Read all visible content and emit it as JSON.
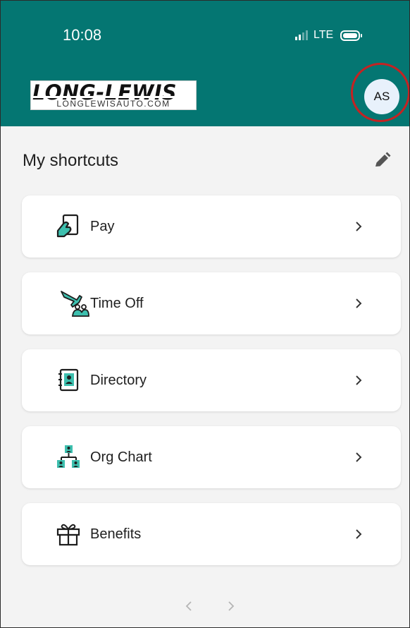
{
  "status_bar": {
    "time": "10:08",
    "network": "LTE"
  },
  "header": {
    "logo_main": "LONG-LEWIS",
    "logo_sub": "LONGLEWISAUTO.COM",
    "avatar_initials": "AS"
  },
  "colors": {
    "header_bg": "#047672",
    "accent_icon": "#0b7f72",
    "highlight_ring": "#c52222"
  },
  "shortcuts": {
    "title": "My shortcuts",
    "edit_icon": "pencil-icon",
    "items": [
      {
        "label": "Pay",
        "icon": "pay-icon"
      },
      {
        "label": "Time Off",
        "icon": "time-off-icon"
      },
      {
        "label": "Directory",
        "icon": "directory-icon"
      },
      {
        "label": "Org Chart",
        "icon": "org-chart-icon"
      },
      {
        "label": "Benefits",
        "icon": "benefits-icon"
      }
    ]
  },
  "pager": {
    "prev_icon": "chevron-left-icon",
    "next_icon": "chevron-right-icon"
  }
}
